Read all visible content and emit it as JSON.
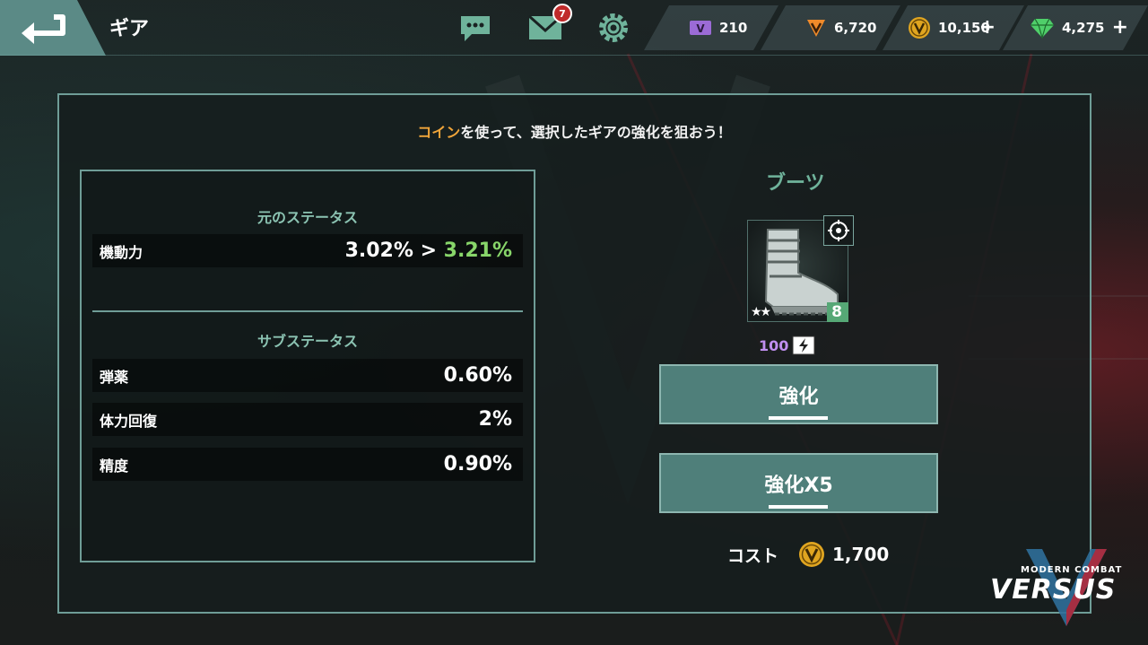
{
  "header": {
    "title": "ギア",
    "mail_badge": "7"
  },
  "currencies": [
    {
      "icon": "ticket-icon",
      "value": "210",
      "color": "#9b6bd6"
    },
    {
      "icon": "v-token-orange-icon",
      "value": "6,720",
      "color": "#f08a2a"
    },
    {
      "icon": "v-coin-gold-icon",
      "value": "10,150",
      "color": "#e0a520",
      "plus": "+"
    },
    {
      "icon": "gem-icon",
      "value": "4,275",
      "color": "#4fcf6a",
      "plus": "+"
    }
  ],
  "panel": {
    "message_highlight": "コイン",
    "message_rest": "を使って、選択したギアの強化を狙おう！"
  },
  "stats": {
    "original_title": "元のステータス",
    "main": {
      "label": "機動力",
      "current": "3.02%",
      "arrow": ">",
      "next": "3.21%"
    },
    "sub_title": "サブステータス",
    "sub": [
      {
        "label": "弾薬",
        "value": "0.60%"
      },
      {
        "label": "体力回復",
        "value": "2%"
      },
      {
        "label": "精度",
        "value": "0.90%"
      }
    ]
  },
  "gear": {
    "name": "ブーツ",
    "stars": "★★",
    "level": "8",
    "upgrade_cost": "100"
  },
  "buttons": {
    "enhance": "強化",
    "enhance_x5": "強化X5"
  },
  "cost": {
    "label": "コスト",
    "value": "1,700"
  },
  "logo": {
    "small": "MODERN COMBAT",
    "big": "VERSUS"
  },
  "colors": {
    "accent": "#6f9d97",
    "highlight_orange": "#f0a53a",
    "stat_increase": "#88d66a",
    "section_title": "#8bc3b2",
    "button": "#4f7f7a"
  }
}
